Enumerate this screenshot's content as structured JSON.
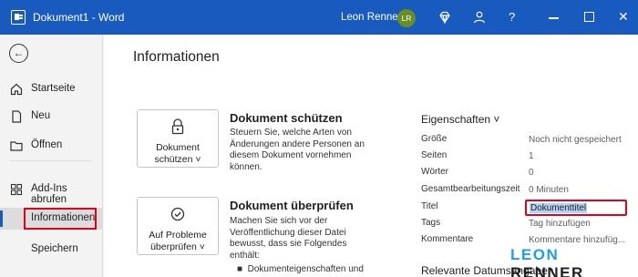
{
  "titlebar": {
    "doc_title": "Dokument1  -  Word",
    "user_name": "Leon Renner",
    "avatar_initials": "LR",
    "help_label": "?"
  },
  "sidebar": {
    "items": [
      {
        "label": "Startseite",
        "icon": "home-icon"
      },
      {
        "label": "Neu",
        "icon": "new-document-icon"
      },
      {
        "label": "Öffnen",
        "icon": "folder-icon"
      },
      {
        "label": "Add-Ins abrufen",
        "icon": "grid-icon"
      },
      {
        "label": "Informationen",
        "icon": ""
      },
      {
        "label": "Speichern",
        "icon": ""
      }
    ]
  },
  "main": {
    "title": "Informationen",
    "protect": {
      "button_line1": "Dokument",
      "button_line2": "schützen ˅",
      "title": "Dokument schützen",
      "desc": "Steuern Sie, welche Arten von Änderungen andere Personen an diesem Dokument vornehmen können."
    },
    "inspect": {
      "button_line1": "Auf Probleme",
      "button_line2": "überprüfen ˅",
      "title": "Dokument überprüfen",
      "desc": "Machen Sie sich vor der Veröffentlichung dieser Datei bewusst, dass sie Folgendes enthält:",
      "bullet": "Dokumenteigenschaften und"
    },
    "properties": {
      "heading": "Eigenschaften ˅",
      "rows": [
        {
          "label": "Größe",
          "value": "Noch nicht gespeichert"
        },
        {
          "label": "Seiten",
          "value": "1"
        },
        {
          "label": "Wörter",
          "value": "0"
        },
        {
          "label": "Gesamtbearbeitungszeit",
          "value": "0 Minuten"
        },
        {
          "label": "Titel",
          "value": "Dokumenttitel"
        },
        {
          "label": "Tags",
          "value": "Tag hinzufügen"
        },
        {
          "label": "Kommentare",
          "value": "Kommentare hinzufüg..."
        }
      ]
    },
    "dates_heading": "Relevante Datumsangaben"
  },
  "brand": {
    "part1": "LEON",
    "part2": "RENNER"
  },
  "colors": {
    "titlebar": "#185abd",
    "highlight": "#e3001b",
    "avatar": "#6b8e23",
    "brand_blue": "#1fa0e6"
  }
}
